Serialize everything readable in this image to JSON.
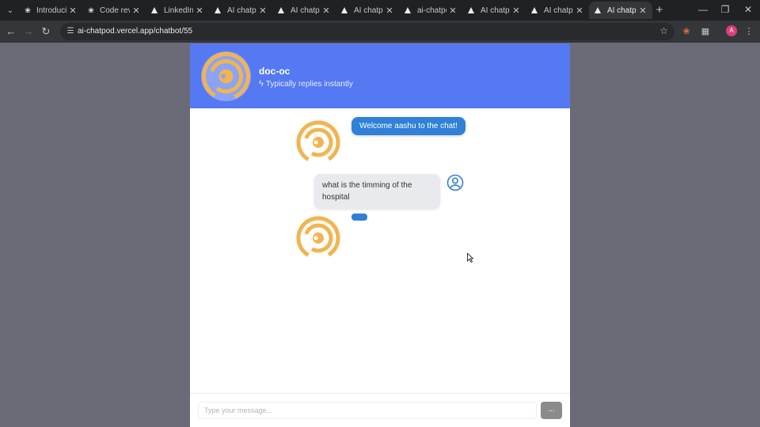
{
  "browser": {
    "tabs": [
      {
        "title": "Introducin",
        "favicon": "openai-icon"
      },
      {
        "title": "Code revie",
        "favicon": "openai-icon"
      },
      {
        "title": "LinkedIn C",
        "favicon": "triangle-icon"
      },
      {
        "title": "AI chatpod",
        "favicon": "triangle-icon"
      },
      {
        "title": "AI chatpod",
        "favicon": "triangle-icon"
      },
      {
        "title": "AI chatpod",
        "favicon": "triangle-icon"
      },
      {
        "title": "ai-chatpo",
        "favicon": "triangle-icon"
      },
      {
        "title": "AI chatpo",
        "favicon": "triangle-icon"
      },
      {
        "title": "AI chatpo",
        "favicon": "triangle-icon"
      },
      {
        "title": "AI chatpo",
        "favicon": "triangle-icon",
        "active": true
      }
    ],
    "url": "ai-chatpod.vercel.app/chatbot/55",
    "profile_initial": "A"
  },
  "chat": {
    "bot_name": "doc-oc",
    "status": "Typically replies instantly",
    "messages": [
      {
        "role": "bot",
        "text": "Welcome aashu to the chat!"
      },
      {
        "role": "user",
        "text": "what is the timming of the hospital"
      },
      {
        "role": "bot",
        "text": ""
      }
    ],
    "input_placeholder": "Type your message...",
    "send_label": "..."
  },
  "colors": {
    "header": "#5579f2",
    "bot_bubble": "#2f80d6",
    "user_bubble": "#e8eaed",
    "logo": "#f2b451"
  }
}
